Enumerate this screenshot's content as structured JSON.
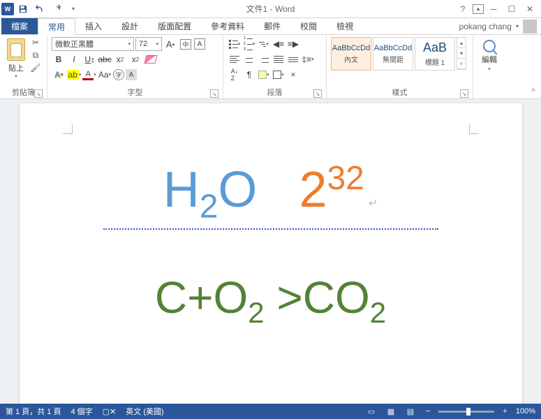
{
  "title": {
    "doc": "文件1",
    "app": "Word"
  },
  "user": "pokang chang",
  "tabs": {
    "file": "檔案",
    "items": [
      "常用",
      "插入",
      "設計",
      "版面配置",
      "參考資料",
      "郵件",
      "校閱",
      "檢視"
    ],
    "active_index": 0
  },
  "ribbon": {
    "clipboard": {
      "paste": "貼上",
      "group": "剪貼簿"
    },
    "font": {
      "name": "微軟正黑體",
      "size": "72",
      "phonetic": "中",
      "group": "字型"
    },
    "paragraph": {
      "group": "段落"
    },
    "styles": {
      "items": [
        {
          "preview": "AaBbCcDd",
          "name": "內文",
          "active": true
        },
        {
          "preview": "AaBbCcDd",
          "name": "無間距",
          "active": false
        },
        {
          "preview": "AaB",
          "name": "標題 1",
          "active": false
        }
      ],
      "group": "樣式"
    },
    "editing": {
      "group": "編輯"
    }
  },
  "document": {
    "line1_h2o": {
      "base1": "H",
      "sub": "2",
      "base2": "O"
    },
    "line1_exp": {
      "base": "2",
      "sup": "32"
    },
    "line2": {
      "t1": "C+O",
      "s1": "2",
      "t2": " >CO",
      "s2": "2"
    }
  },
  "statusbar": {
    "page": "第 1 頁，共 1 頁",
    "words": "4 個字",
    "lang": "英文 (美國)",
    "zoom": "100%"
  }
}
